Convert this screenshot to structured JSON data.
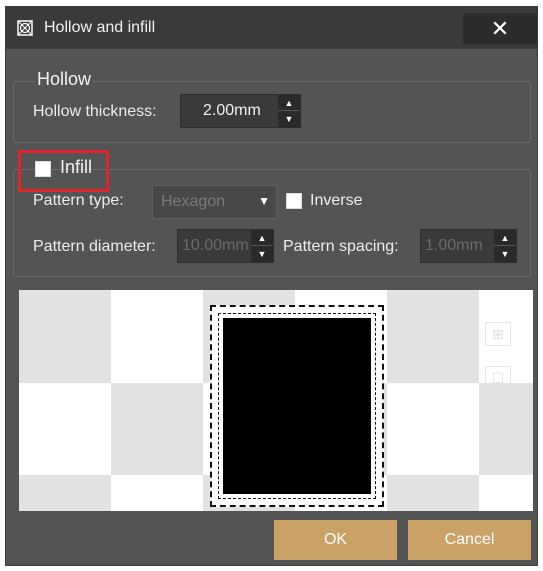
{
  "window": {
    "title": "Hollow and infill",
    "close_glyph": "✕"
  },
  "hollow": {
    "group_label": "Hollow",
    "thickness_label": "Hollow thickness:",
    "thickness_value": "2.00mm"
  },
  "infill": {
    "checkbox_label": "Infill",
    "checked": false,
    "pattern_type_label": "Pattern type:",
    "pattern_type_value": "Hexagon",
    "inverse_label": "Inverse",
    "inverse_checked": false,
    "pattern_diameter_label": "Pattern diameter:",
    "pattern_diameter_value": "10.00mm",
    "pattern_spacing_label": "Pattern spacing:",
    "pattern_spacing_value": "1.00mm"
  },
  "preview": {
    "tool_icons": [
      "grid-icon",
      "frame-icon"
    ]
  },
  "buttons": {
    "ok_label": "OK",
    "cancel_label": "Cancel"
  },
  "colors": {
    "accent": "#cba266",
    "highlight": "#e0262a",
    "background": "#545454"
  }
}
